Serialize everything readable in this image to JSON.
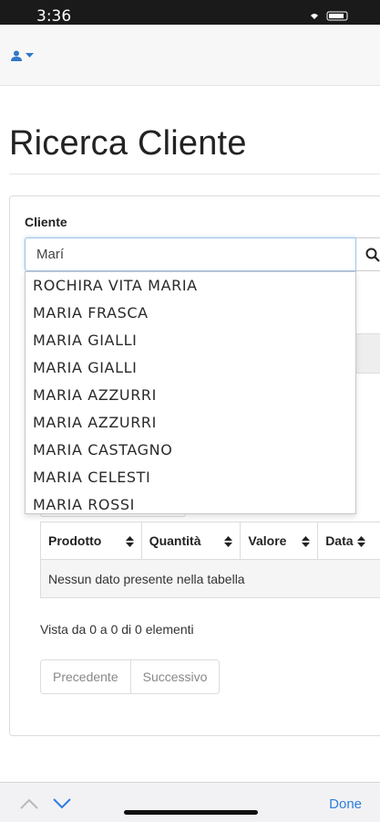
{
  "status_bar": {
    "time": "3:36"
  },
  "page": {
    "title": "Ricerca Cliente"
  },
  "form": {
    "label": "Cliente",
    "input_value": "Marí",
    "search_icon": "search-icon"
  },
  "autocomplete": {
    "items": [
      "ROCHIRA VITA MARIA",
      "MARIA FRASCA",
      "MARIA GIALLI",
      "MARIA GIALLI",
      "MARIA AZZURRI",
      "MARIA AZZURRI",
      "MARIA CASTAGNO",
      "MARIA CELESTI",
      "MARIA ROSSI"
    ]
  },
  "table": {
    "headers": [
      "Prodotto",
      "Quantità",
      "Valore",
      "Data"
    ],
    "empty_message": "Nessun dato presente nella tabella"
  },
  "info": "Vista da 0 a 0 di 0 elementi",
  "pagination": {
    "prev": "Precedente",
    "next": "Successivo"
  },
  "keyboard_bar": {
    "done": "Done"
  },
  "colors": {
    "accent": "#3178c6",
    "done": "#2f7de1"
  }
}
